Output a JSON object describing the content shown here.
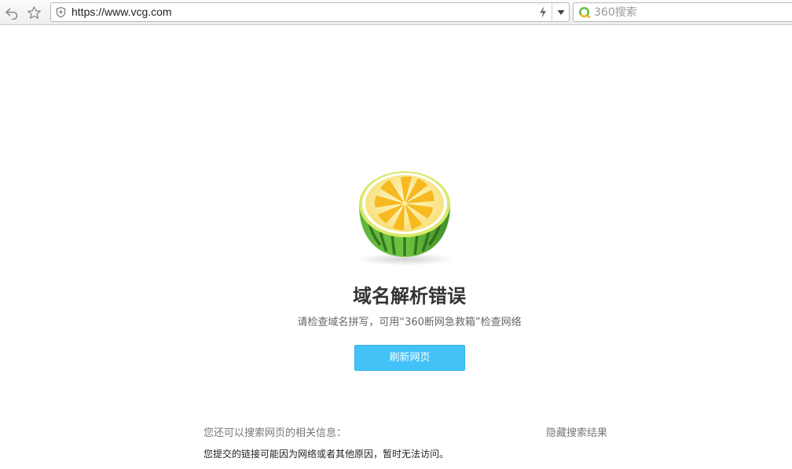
{
  "browser": {
    "url": "https://www.vcg.com",
    "search_placeholder": "360搜索"
  },
  "icons": {
    "back": "back-icon",
    "favorite": "star-icon",
    "security": "shield-icon",
    "speed": "lightning-icon",
    "dropdown": "chevron-down-icon",
    "search_engine": "search-logo-icon",
    "error_logo": "lemon-icon"
  },
  "error_page": {
    "title": "域名解析错误",
    "subtitle": "请检查域名拼写，可用“360断网急救箱”检查网络",
    "refresh_label": "刷新网页",
    "search_info_label": "您还可以搜索网页的相关信息：",
    "hide_results_label": "隐藏搜索结果",
    "info_message": "您提交的链接可能因为网络或者其他原因，暂时无法访问。"
  },
  "colors": {
    "button": "#42c2f7",
    "title": "#333333",
    "subtitle": "#666666"
  }
}
